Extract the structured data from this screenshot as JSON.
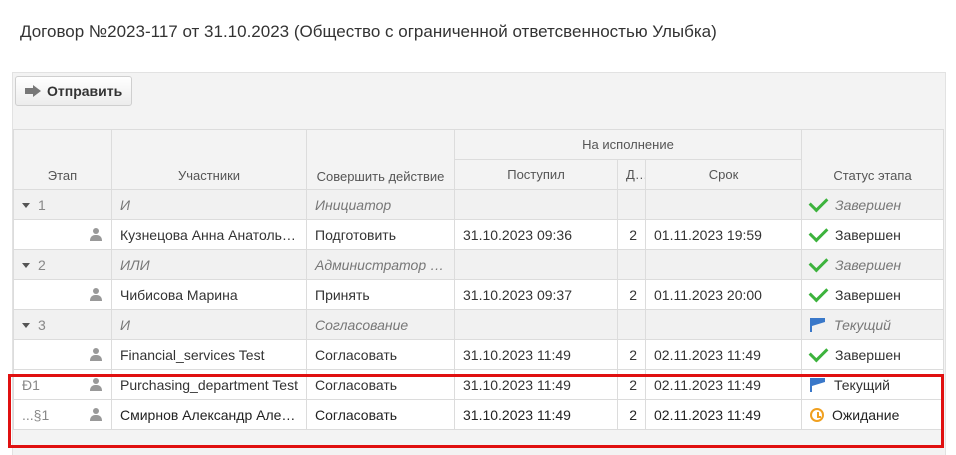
{
  "title": "Договор №2023-117 от 31.10.2023 (Общество с ограниченной ответсвенностью Улыбка)",
  "toolbar": {
    "send_label": "Отправить"
  },
  "headers": {
    "stage": "Этап",
    "participants": "Участники",
    "action": "Совершить действие",
    "execution": "На исполнение",
    "received": "Поступил",
    "days": "Дн",
    "deadline": "Срок",
    "status": "Статус этапа"
  },
  "rows": [
    {
      "type": "group",
      "stage": "1",
      "participant": "И",
      "action": "Инициатор",
      "received": "",
      "days": "",
      "deadline": "",
      "status": "Завершен",
      "status_icon": "check-icon"
    },
    {
      "type": "row",
      "stage": "",
      "participant": "Кузнецова Анна Анатольевна",
      "action": "Подготовить",
      "received": "31.10.2023 09:36",
      "days": "2",
      "deadline": "01.11.2023 19:59",
      "status": "Завершен",
      "status_icon": "check-icon"
    },
    {
      "type": "group",
      "stage": "2",
      "participant": "ИЛИ",
      "action": "Администратор системы",
      "received": "",
      "days": "",
      "deadline": "",
      "status": "Завершен",
      "status_icon": "check-icon"
    },
    {
      "type": "row",
      "stage": "",
      "participant": "Чибисова Марина",
      "action": "Принять",
      "received": "31.10.2023 09:37",
      "days": "2",
      "deadline": "01.11.2023 20:00",
      "status": "Завершен",
      "status_icon": "check-icon"
    },
    {
      "type": "group",
      "stage": "3",
      "participant": "И",
      "action": "Согласование",
      "received": "",
      "days": "",
      "deadline": "",
      "status": "Текущий",
      "status_icon": "flag-icon"
    },
    {
      "type": "row",
      "stage": "",
      "participant": "Financial_services Test",
      "action": "Согласовать",
      "received": "31.10.2023 11:49",
      "days": "2",
      "deadline": "02.11.2023 11:49",
      "status": "Завершен",
      "status_icon": "check-icon"
    },
    {
      "type": "row",
      "stage": "Ð1",
      "participant": "Purchasing_department Test",
      "action": "Согласовать",
      "received": "31.10.2023 11:49",
      "days": "2",
      "deadline": "02.11.2023 11:49",
      "status": "Текущий",
      "status_icon": "flag-icon"
    },
    {
      "type": "row",
      "stage": "...§1",
      "participant": "Смирнов Александр Александрович",
      "action": "Согласовать",
      "received": "31.10.2023 11:49",
      "days": "2",
      "deadline": "02.11.2023 11:49",
      "status": "Ожидание",
      "status_icon": "clock-icon",
      "dark": true
    }
  ]
}
